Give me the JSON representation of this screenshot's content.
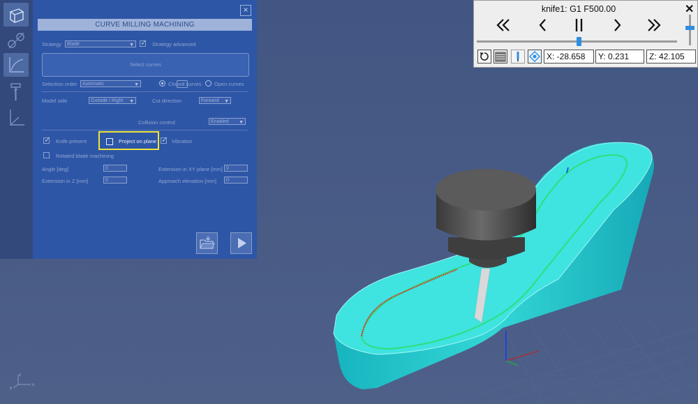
{
  "dialog": {
    "title": "CURVE MILLING MACHINING",
    "close_label": "×",
    "strategy_label": "Strategy",
    "strategy_value": "Blade",
    "strategy_advanced_label": "Strategy advanced",
    "select_curves_label": "Select curves",
    "selection_order_label": "Selection order",
    "selection_order_value": "Automatic",
    "dots_label": "...",
    "closed_curves_label": "Closed curves",
    "open_curves_label": "Open curves",
    "model_side_label": "Model side",
    "model_side_value": "Outside / Right",
    "cut_direction_label": "Cut direction",
    "cut_direction_value": "Forward",
    "collision_control_label": "Collision control",
    "collision_control_value": "Enabled",
    "knife_present_label": "Knife present",
    "project_on_plane_label": "Project on plane",
    "vibration_label": "Vibration",
    "rotated_blade_label": "Rotated blade machining",
    "angle_label": "Angle [deg]",
    "angle_value": "0",
    "ext_xy_label": "Extension in XY plane [mm]",
    "ext_xy_value": "0",
    "ext_z_label": "Extension in Z [mm]",
    "ext_z_value": "0",
    "approach_label": "Approach elevation [mm]",
    "approach_value": "0"
  },
  "player": {
    "title": "knife1: G1 F500.00",
    "close_label": "✕",
    "x_readout": "X: -28.658",
    "y_readout": "Y: 0.231",
    "z_readout": "Z: 42.105",
    "timeline_progress": 0.51,
    "speed_level": 0.43
  },
  "scene": {
    "axis_x": "x",
    "axis_y": "y",
    "axis_z": "z"
  },
  "colors": {
    "viewport": "#425683",
    "dialog": "#2e56a6",
    "toolstrip": "#33497c",
    "highlight": "#efe43b",
    "model": "#22c9c9",
    "toolpath": "#2de07a",
    "cut_path": "#d33a2a",
    "accent": "#2f8ee0"
  }
}
